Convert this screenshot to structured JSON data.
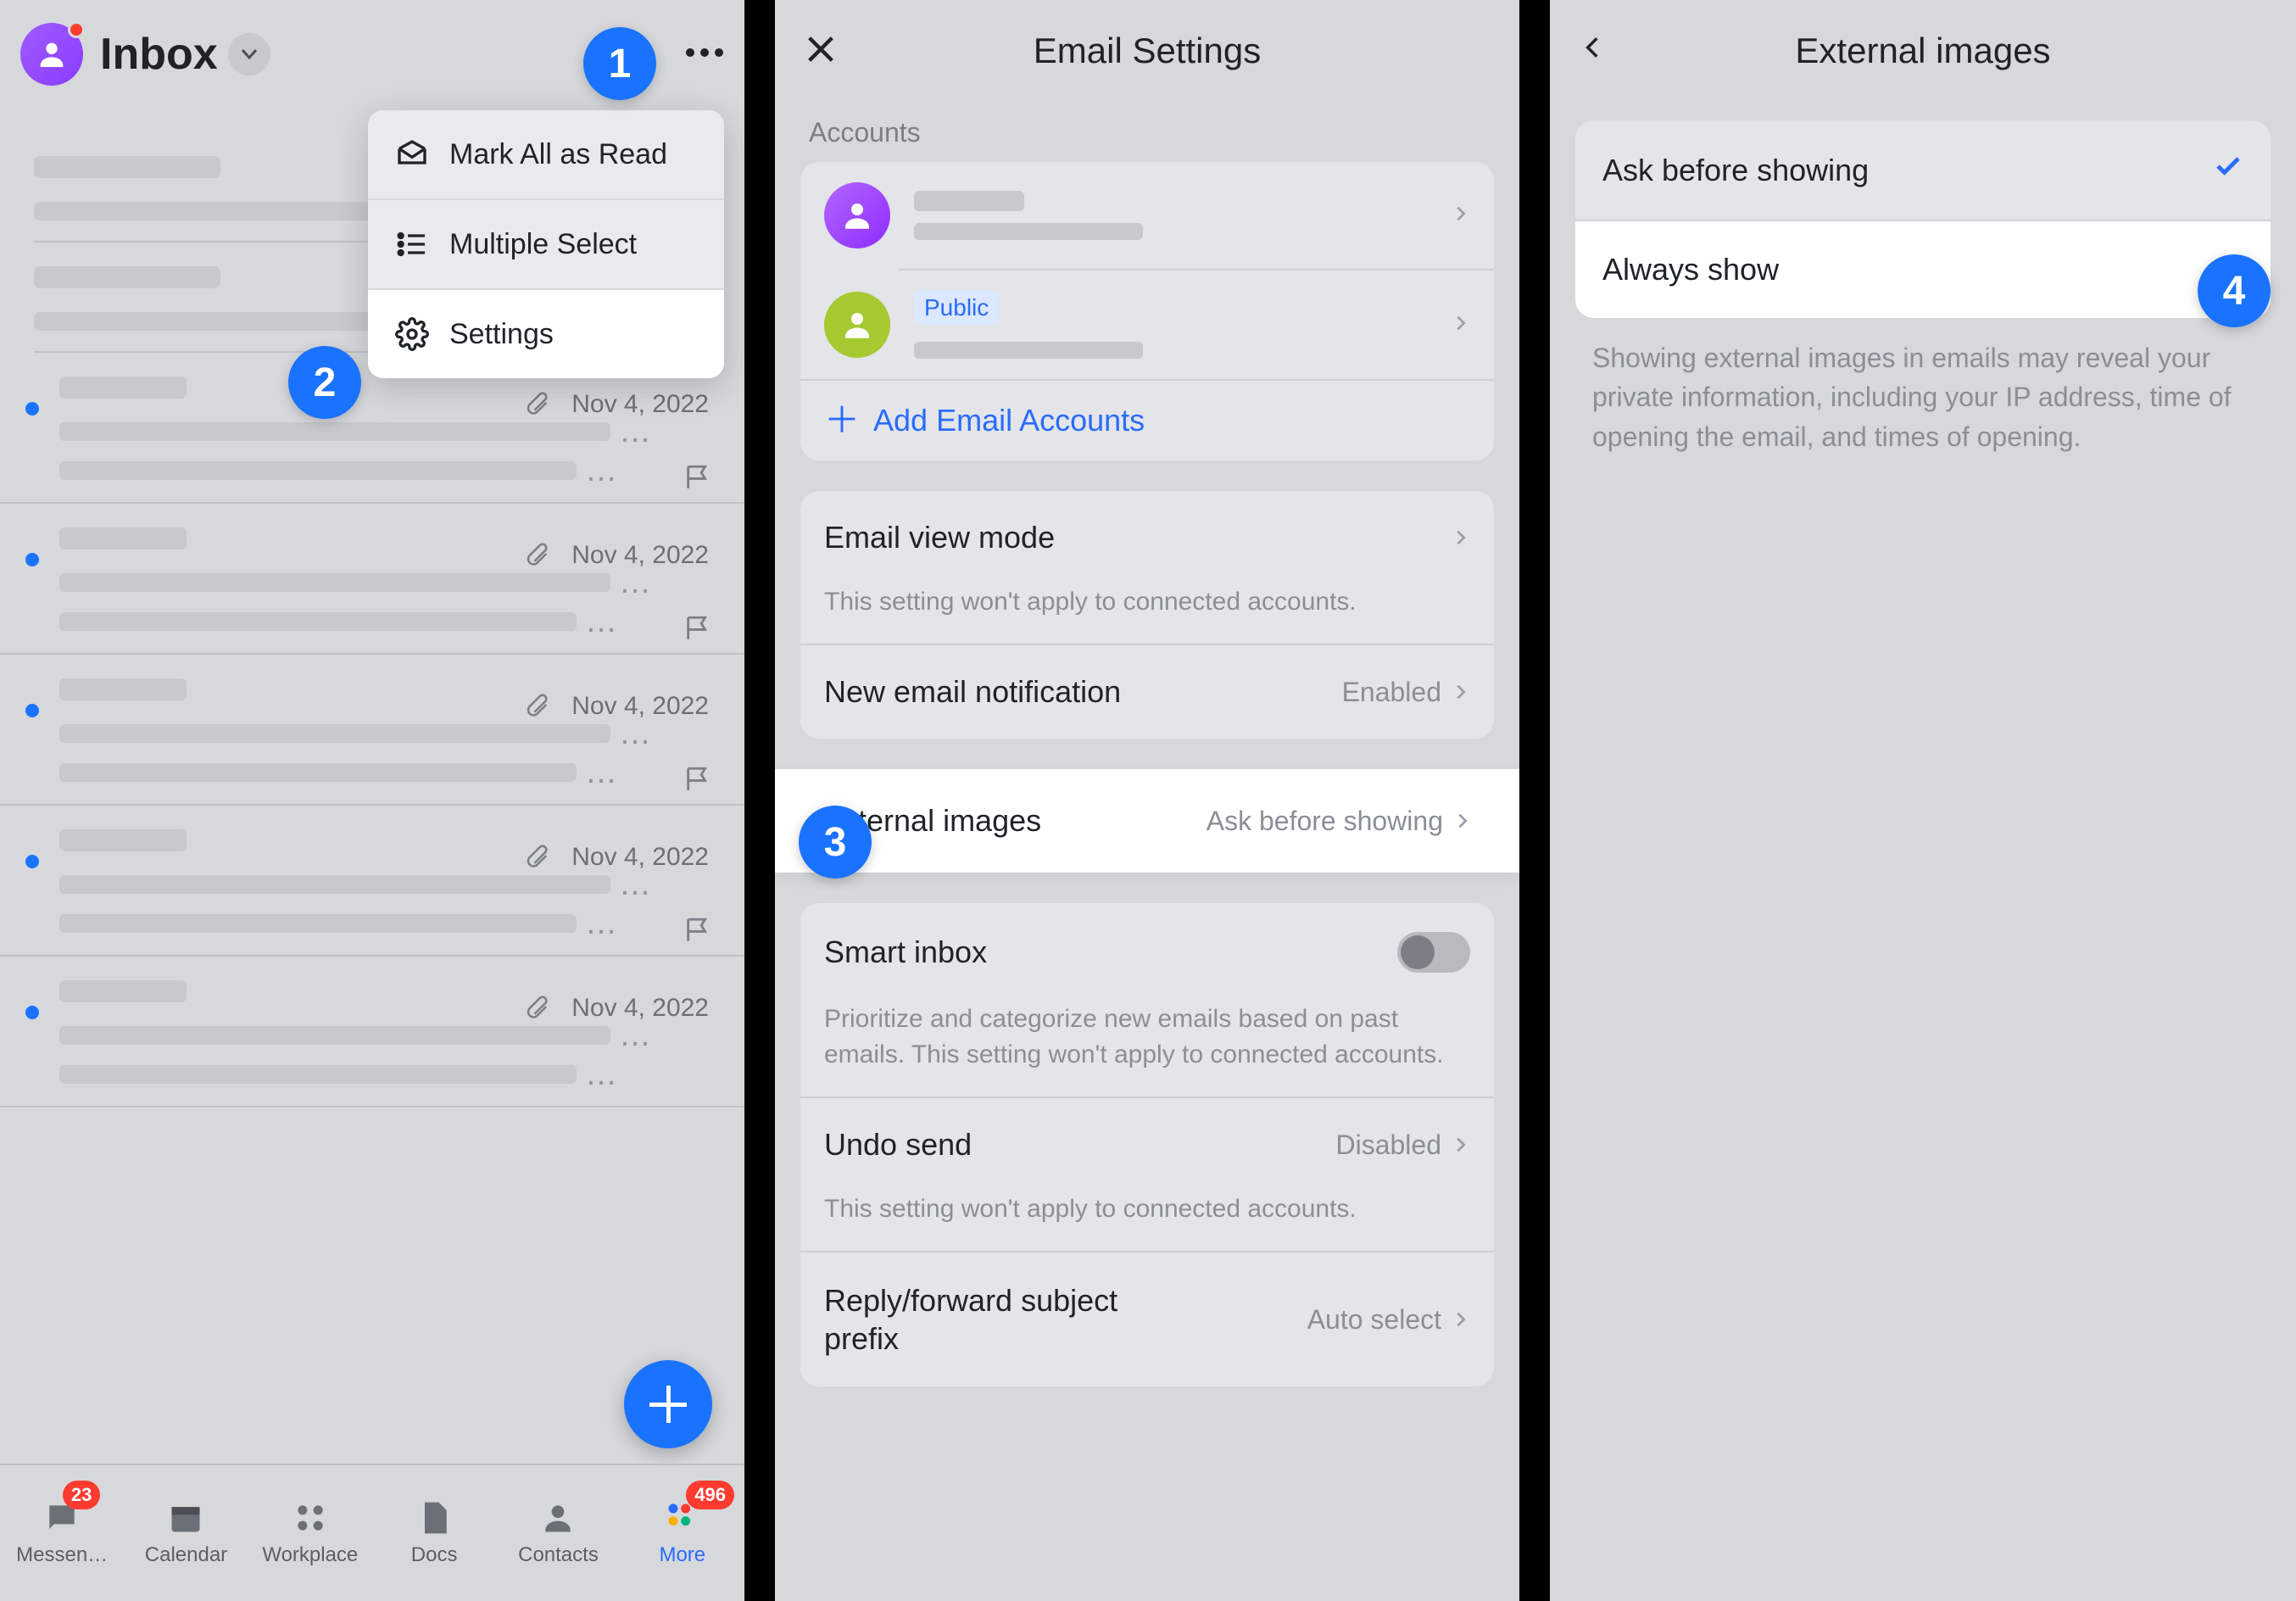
{
  "steps": {
    "s1": "1",
    "s2": "2",
    "s3": "3",
    "s4": "4"
  },
  "panelA": {
    "title": "Inbox",
    "menu": {
      "markAll": "Mark All as Read",
      "multi": "Multiple Select",
      "settings": "Settings"
    },
    "date": "Nov 4, 2022",
    "nav": {
      "messenger": "Messen…",
      "calendar": "Calendar",
      "workplace": "Workplace",
      "docs": "Docs",
      "contacts": "Contacts",
      "more": "More",
      "b1": "23",
      "b2": "496"
    }
  },
  "panelB": {
    "title": "Email Settings",
    "accounts": "Accounts",
    "public": "Public",
    "add": "Add Email Accounts",
    "viewMode": "Email view mode",
    "viewModeSub": "This setting won't apply to connected accounts.",
    "newEmail": "New email notification",
    "enabled": "Enabled",
    "extImages": "External images",
    "extImagesVal": "Ask before showing",
    "smart": "Smart inbox",
    "smartSub": "Prioritize and categorize new emails based on past emails. This setting won't apply to connected accounts.",
    "undo": "Undo send",
    "disabled": "Disabled",
    "undoSub": "This setting won't apply to connected accounts.",
    "prefix": "Reply/forward subject prefix",
    "auto": "Auto select"
  },
  "panelC": {
    "title": "External images",
    "opt1": "Ask before showing",
    "opt2": "Always show",
    "note": "Showing external images in emails may reveal your private information, including your IP address, time of opening the email, and times of opening."
  }
}
